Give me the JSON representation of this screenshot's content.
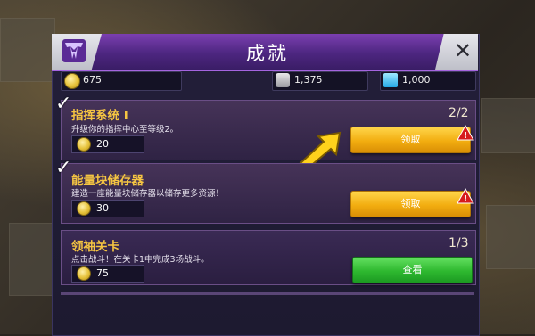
{
  "window": {
    "title": "成就"
  },
  "resources": [
    {
      "icon": "gold-coin-icon",
      "value": "675"
    },
    {
      "icon": "ore-pile-icon",
      "value": "1,375"
    },
    {
      "icon": "energon-cube-icon",
      "value": "1,000"
    }
  ],
  "achievements": [
    {
      "title": "指挥系统 I",
      "desc": "升级你的指挥中心至等级2。",
      "reward": "20",
      "progress": "2/2",
      "button": "领取",
      "completed": true,
      "alert": true
    },
    {
      "title": "能量块储存器",
      "desc": "建造一座能量块储存器以储存更多资源！",
      "reward": "30",
      "progress": "",
      "button": "领取",
      "completed": true,
      "alert": true
    },
    {
      "title": "领袖关卡",
      "desc": "点击战斗！在关卡1中完成3场战斗。",
      "reward": "75",
      "progress": "1/3",
      "button": "查看",
      "completed": false,
      "alert": false
    }
  ],
  "colors": {
    "header": "#4d2680",
    "claim_button": "#f2ad10",
    "view_button": "#2eb82f",
    "title_gold": "#f5c542"
  }
}
